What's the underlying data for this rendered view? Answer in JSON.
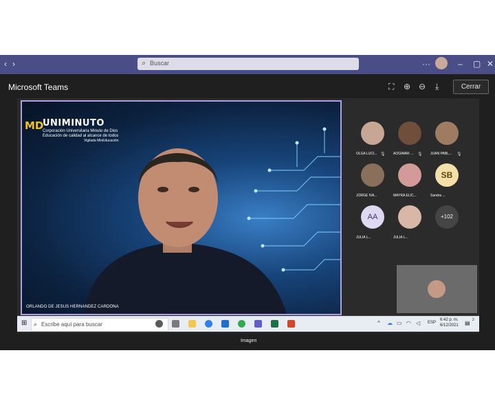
{
  "titlebar": {
    "search_placeholder": "Buscar",
    "more": "···"
  },
  "viewer": {
    "app_title": "Microsoft Teams",
    "close_label": "Cerrar",
    "caption": "Imagen"
  },
  "main_video": {
    "logo_mark": "MD",
    "logo_name": "UNIMINUTO",
    "logo_line1": "Corporación Universitaria Minuto de Dios",
    "logo_line2": "Educación de calidad al alcance de todos",
    "logo_line3": "Vigilada MinEducación",
    "presenter_name": "ORLANDO DE JESUS HERNANDEZ CARDONA"
  },
  "participants": [
    {
      "name": "OLGA LUCI...",
      "color": "#c7a694"
    },
    {
      "name": "AOGIMAR ...",
      "color": "#6f4f3c"
    },
    {
      "name": "JUAN PABL...",
      "color": "#9f7b62"
    },
    {
      "name": "JORGE IVA...",
      "color": "#8a6f5b"
    },
    {
      "name": "MAYRA ELIC...",
      "color": "#d39a9a"
    },
    {
      "name": "Sandra ...",
      "initials": "SB",
      "color": "#f3dfa7"
    },
    {
      "name": "JULIA L...",
      "initials": "AA",
      "color": "#ded8f2"
    },
    {
      "name": "JULIA L...",
      "color": "#d8b7a7"
    },
    {
      "name": "",
      "initials": "+102",
      "color": "#454545"
    }
  ],
  "taskbar": {
    "search_placeholder": "Escribe aquí para buscar",
    "lang": "ESP",
    "time": "6:42 p. m.",
    "date": "6/12/2021",
    "notif": "2"
  }
}
